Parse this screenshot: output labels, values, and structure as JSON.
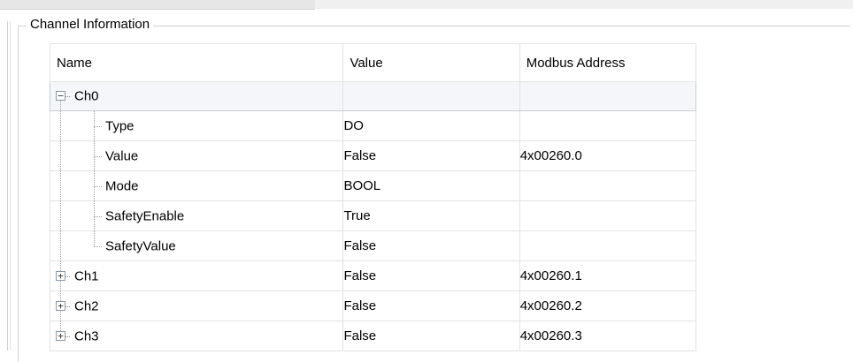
{
  "group": {
    "title": "Channel Information"
  },
  "columns": {
    "name": "Name",
    "value": "Value",
    "modbus": "Modbus Address"
  },
  "rows": [
    {
      "name": "Ch0",
      "value": "",
      "modbus": "",
      "expander": "−"
    },
    {
      "name": "Type",
      "value": "DO",
      "modbus": ""
    },
    {
      "name": "Value",
      "value": "False",
      "modbus": "4x00260.0"
    },
    {
      "name": "Mode",
      "value": "BOOL",
      "modbus": ""
    },
    {
      "name": "SafetyEnable",
      "value": "True",
      "modbus": ""
    },
    {
      "name": "SafetyValue",
      "value": "False",
      "modbus": ""
    },
    {
      "name": "Ch1",
      "value": "False",
      "modbus": "4x00260.1",
      "expander": "+"
    },
    {
      "name": "Ch2",
      "value": "False",
      "modbus": "4x00260.2",
      "expander": "+"
    },
    {
      "name": "Ch3",
      "value": "False",
      "modbus": "4x00260.3",
      "expander": "+"
    }
  ],
  "icons": {
    "expand": "plus-box-icon",
    "collapse": "minus-box-icon"
  }
}
